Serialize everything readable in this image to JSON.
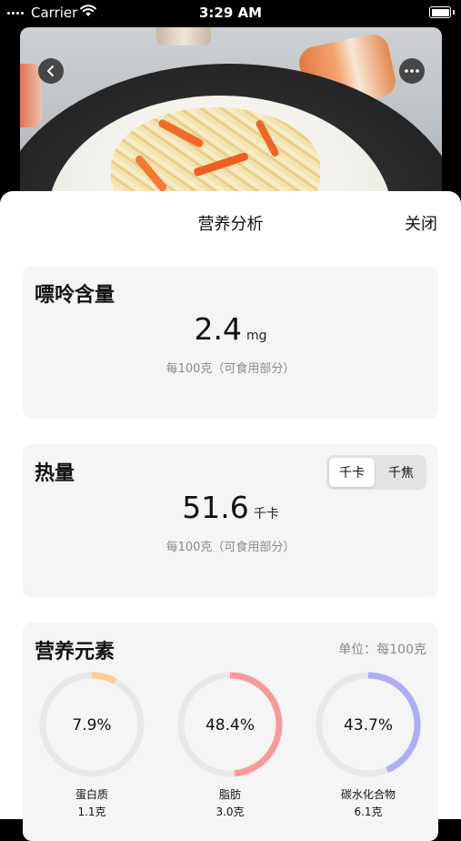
{
  "status_bar": {
    "carrier": "Carrier",
    "time": "3:29 AM"
  },
  "sheet": {
    "title": "营养分析",
    "close_label": "关闭"
  },
  "purine": {
    "title": "嘌呤含量",
    "value": "2.4",
    "unit": "mg",
    "note": "每100克（可食用部分）"
  },
  "energy": {
    "title": "热量",
    "value": "51.6",
    "unit": "千卡",
    "note": "每100克（可食用部分）",
    "toggle": {
      "options": [
        "千卡",
        "千焦"
      ],
      "selected": "千卡"
    }
  },
  "nutrients": {
    "title": "营养元素",
    "unit_note": "单位：每100克",
    "items": [
      {
        "name": "蛋白质",
        "amount": "1.1克",
        "percent_label": "7.9%",
        "percent": 7.9,
        "color": "#FFCB99"
      },
      {
        "name": "脂肪",
        "amount": "3.0克",
        "percent_label": "48.4%",
        "percent": 48.4,
        "color": "#F79A98"
      },
      {
        "name": "碳水化合物",
        "amount": "6.1克",
        "percent_label": "43.7%",
        "percent": 43.7,
        "color": "#ADADF7"
      }
    ],
    "track_color": "#E8E8E8"
  },
  "icons": {
    "back": "chevron-left-icon",
    "more": "more-horizontal-icon"
  }
}
